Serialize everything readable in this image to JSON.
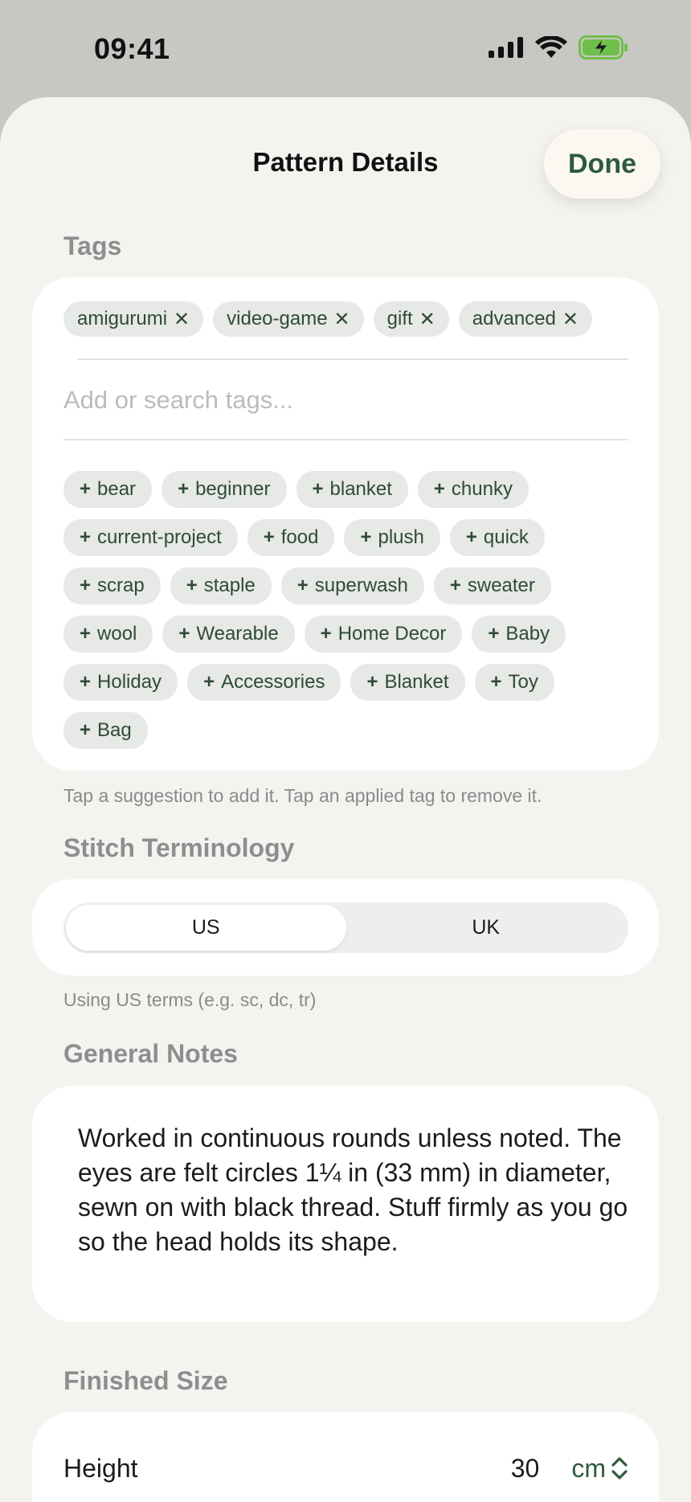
{
  "status": {
    "time": "09:41"
  },
  "header": {
    "title": "Pattern Details",
    "done_label": "Done"
  },
  "tags": {
    "section_label": "Tags",
    "applied": [
      "amigurumi",
      "video-game",
      "gift",
      "advanced"
    ],
    "search_placeholder": "Add or search tags...",
    "suggestions": [
      "bear",
      "beginner",
      "blanket",
      "chunky",
      "current-project",
      "food",
      "plush",
      "quick",
      "scrap",
      "staple",
      "superwash",
      "sweater",
      "wool",
      "Wearable",
      "Home Decor",
      "Baby",
      "Holiday",
      "Accessories",
      "Blanket",
      "Toy",
      "Bag"
    ],
    "remove_glyph": "✕",
    "add_glyph": "+",
    "help": "Tap a suggestion to add it. Tap an applied tag to remove it."
  },
  "terminology": {
    "section_label": "Stitch Terminology",
    "options": [
      "US",
      "UK"
    ],
    "selected": "US",
    "help": "Using US terms (e.g. sc, dc, tr)"
  },
  "notes": {
    "section_label": "General Notes",
    "text": "Worked in continuous rounds unless noted. The eyes are felt circles 1¼ in (33 mm) in diameter, sewn on with black thread. Stuff firmly as you go so the head holds its shape."
  },
  "finished_size": {
    "section_label": "Finished Size",
    "height_label": "Height",
    "height_value": "30",
    "unit": "cm"
  },
  "colors": {
    "accent": "#2f5a3c",
    "chip_bg": "#e6e9e5",
    "sheet_bg": "#f4f3f0"
  }
}
